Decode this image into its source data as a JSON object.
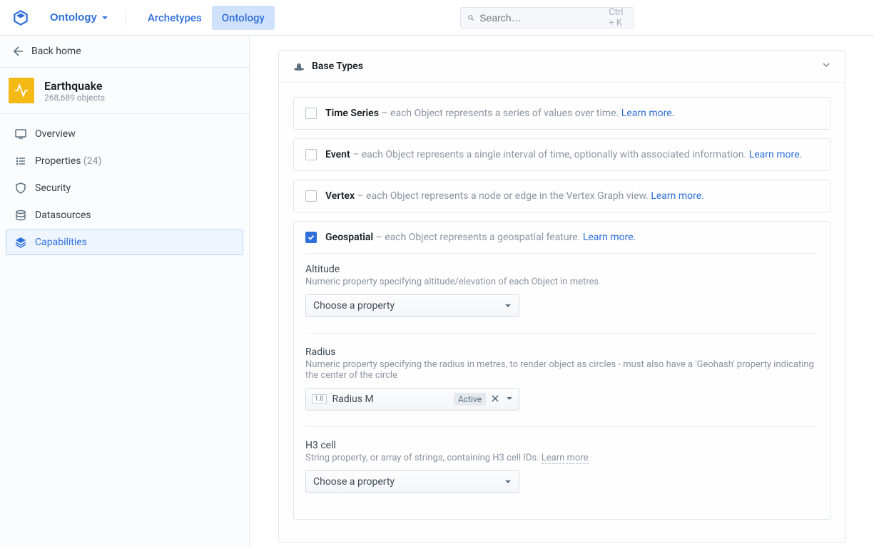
{
  "topbar": {
    "app_dropdown": "Ontology",
    "tab_archetypes": "Archetypes",
    "tab_ontology": "Ontology",
    "search_placeholder": "Search…",
    "search_shortcut": "Ctrl + K"
  },
  "sidebar": {
    "back_label": "Back home",
    "object": {
      "name": "Earthquake",
      "subtitle": "268,689 objects"
    },
    "nav": {
      "overview": "Overview",
      "properties": "Properties",
      "properties_count": "(24)",
      "security": "Security",
      "datasources": "Datasources",
      "capabilities": "Capabilities"
    }
  },
  "card": {
    "title": "Base Types"
  },
  "base_types": {
    "time_series": {
      "label": "Time Series",
      "desc": "– each Object represents a series of values over time.",
      "learn": "Learn more."
    },
    "event": {
      "label": "Event",
      "desc": "– each Object represents a single interval of time, optionally with associated information.",
      "learn": "Learn more."
    },
    "vertex": {
      "label": "Vertex",
      "desc": "– each Object represents a node or edge in the Vertex Graph view.",
      "learn": "Learn more."
    },
    "geospatial": {
      "label": "Geospatial",
      "desc": "– each Object represents a geospatial feature.",
      "learn": "Learn more."
    }
  },
  "geo": {
    "altitude": {
      "title": "Altitude",
      "desc": "Numeric property specifying altitude/elevation of each Object in metres",
      "placeholder": "Choose a property"
    },
    "radius": {
      "title": "Radius",
      "desc": "Numeric property specifying the radius in metres, to render object as circles - must also have a 'Geohash' property indicating the center of the circle",
      "prop_type": "1.0",
      "prop_name": "Radius M",
      "prop_status": "Active"
    },
    "h3": {
      "title": "H3 cell",
      "desc_prefix": "String property, or array of strings, containing H3 cell IDs. ",
      "learn": "Learn more",
      "placeholder": "Choose a property"
    }
  }
}
